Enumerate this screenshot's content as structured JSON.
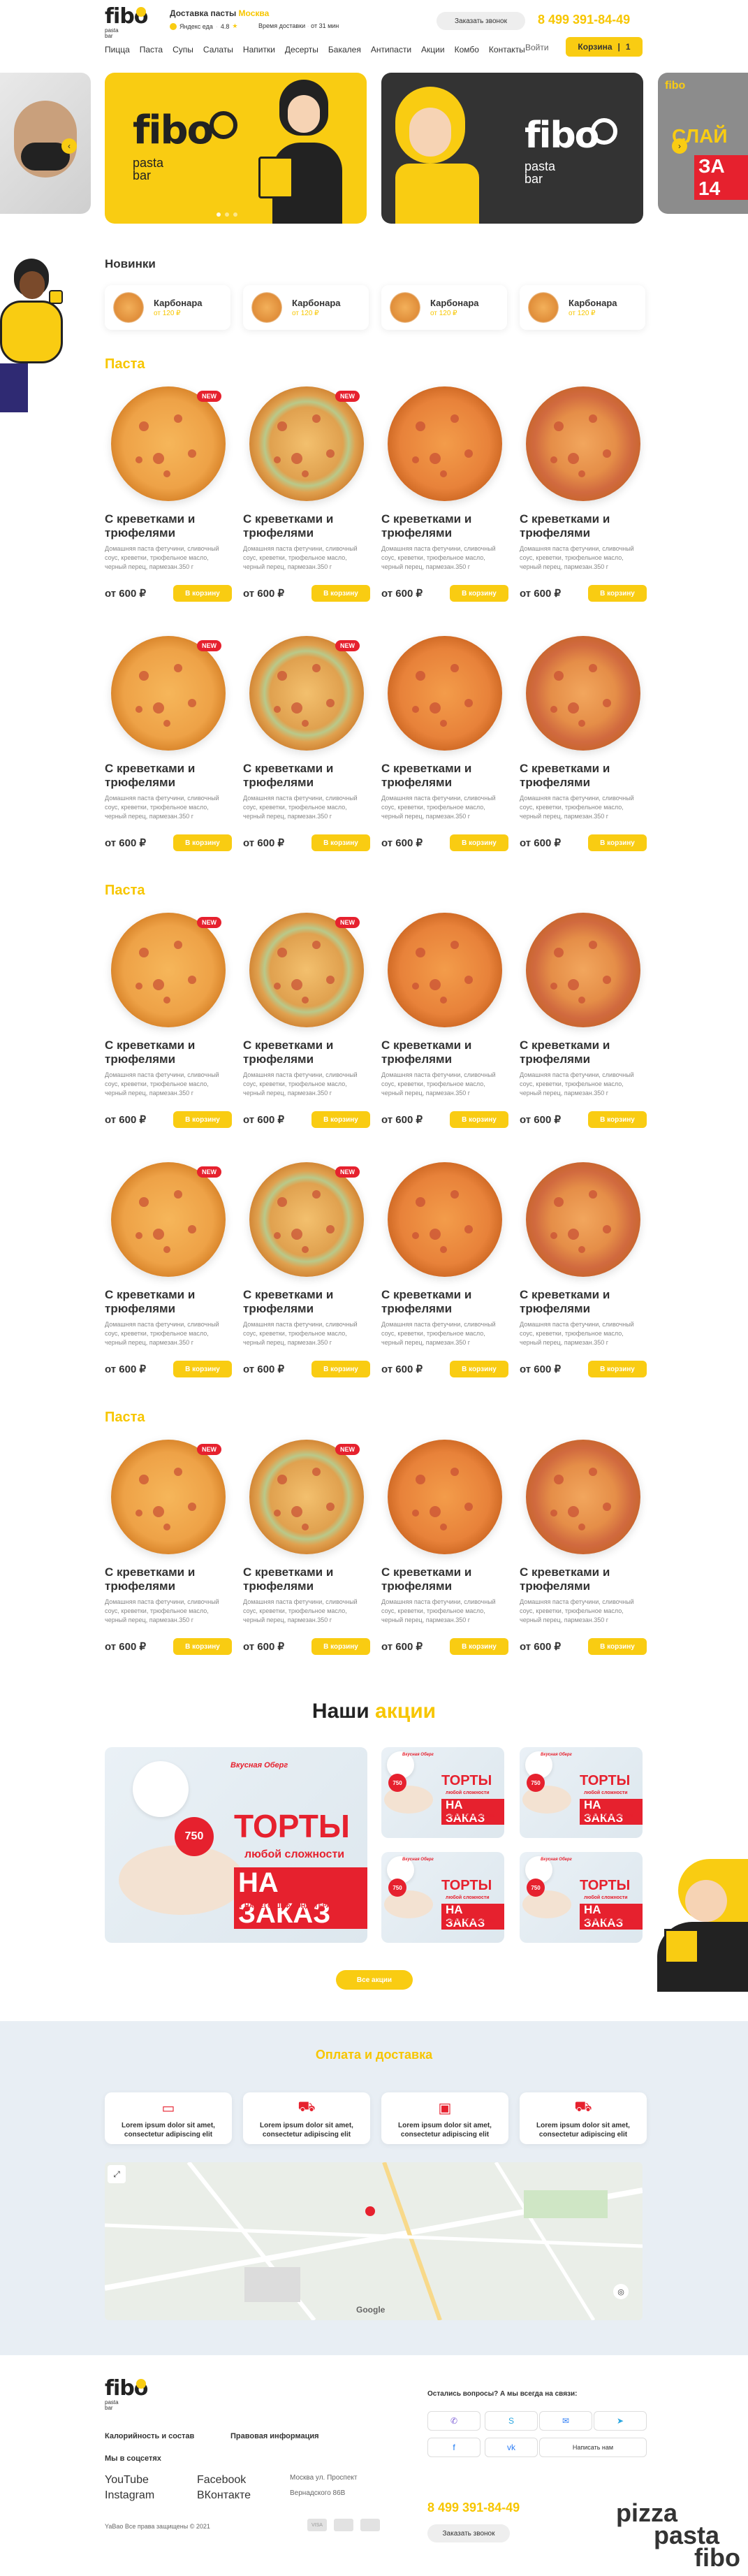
{
  "header": {
    "logo": "fibo",
    "logo_sub": "pasta\nbar",
    "delivery_label": "Доставка пасты",
    "city": "Москва",
    "rating_label": "Яндекс еда",
    "rating_value": "4.8",
    "delivery_time": "Время доставки",
    "time_value": "от 31 мин",
    "call_button": "Заказать звонок",
    "phone": "8 499 391-84-49"
  },
  "nav": {
    "items": [
      "Пицца",
      "Паста",
      "Супы",
      "Салаты",
      "Напитки",
      "Десерты",
      "Бакалея",
      "Антипасти",
      "Акции",
      "Комбо",
      "Контакты"
    ],
    "login": "Войти",
    "cart": "Корзина",
    "cart_count": "1"
  },
  "banners": {
    "left_logo": "fibo",
    "left_sub": "pasta\nbar",
    "right_logo": "fibo",
    "right_sub": "pasta\nbar",
    "partial_right_text": "СЛАЙ",
    "partial_right_sub": "ЗА 14"
  },
  "novinki": {
    "title": "Новинки",
    "items": [
      {
        "name": "Карбонара",
        "price": "от 120 ₽"
      },
      {
        "name": "Карбонара",
        "price": "от 120 ₽"
      },
      {
        "name": "Карбонара",
        "price": "от 120 ₽"
      },
      {
        "name": "Карбонара",
        "price": "от 120 ₽"
      }
    ]
  },
  "sections": [
    {
      "title": "Паста"
    },
    {
      "title": "Паста"
    },
    {
      "title": "Паста"
    }
  ],
  "product": {
    "title": "С креветками и трюфелями",
    "desc": "Домашняя паста фетучини, сливочный соус, креветки, трюфельное масло, черный перец, пармезан.350 г",
    "price": "от 600 ₽",
    "button": "В корзину",
    "badge": "NEW"
  },
  "promo": {
    "title_a": "Наши",
    "title_b": "акции",
    "brand": "Вкусная Оберг",
    "price": "750",
    "unit": "₽/КГ",
    "l1": "ТОРТЫ",
    "l2": "любой сложности",
    "l3": "НА ЗАКАЗ",
    "l4": "ОТ НАШЕГО ШЕФ-КОНДИТЕРА",
    "all_button": "Все акции"
  },
  "payment": {
    "title": "Оплата и доставка",
    "items": [
      {
        "text": "Lorem ipsum dolor sit amet, consectetur adipiscing elit"
      },
      {
        "text": "Lorem ipsum dolor sit amet, consectetur adipiscing elit"
      },
      {
        "text": "Lorem ipsum dolor sit amet, consectetur adipiscing elit"
      },
      {
        "text": "Lorem ipsum dolor sit amet, consectetur adipiscing elit"
      }
    ],
    "map_label": "Google"
  },
  "footer": {
    "logo": "fibo",
    "logo_sub": "pasta\nbar",
    "calories": "Калорийность и состав",
    "legal": "Правовая информация",
    "social_title": "Мы в соцсетях",
    "youtube": "YouTube",
    "facebook": "Facebook",
    "instagram": "Instagram",
    "vk": "ВКонтакте",
    "addr1": "Москва ул. Проспект",
    "addr2": "Вернадского 86В",
    "question": "Остались вопросы? А мы всегда на связи:",
    "write": "Написать нам",
    "phone": "8 499 391-84-49",
    "call_button": "Заказать звонок",
    "copyright": "YaBao Все права защищены © 2021",
    "big_text": [
      "pizza",
      "pasta",
      "fibo"
    ]
  },
  "colors": {
    "accent": "#F9CC12",
    "red": "#E6212E",
    "bg_light": "#E8EEF4"
  }
}
